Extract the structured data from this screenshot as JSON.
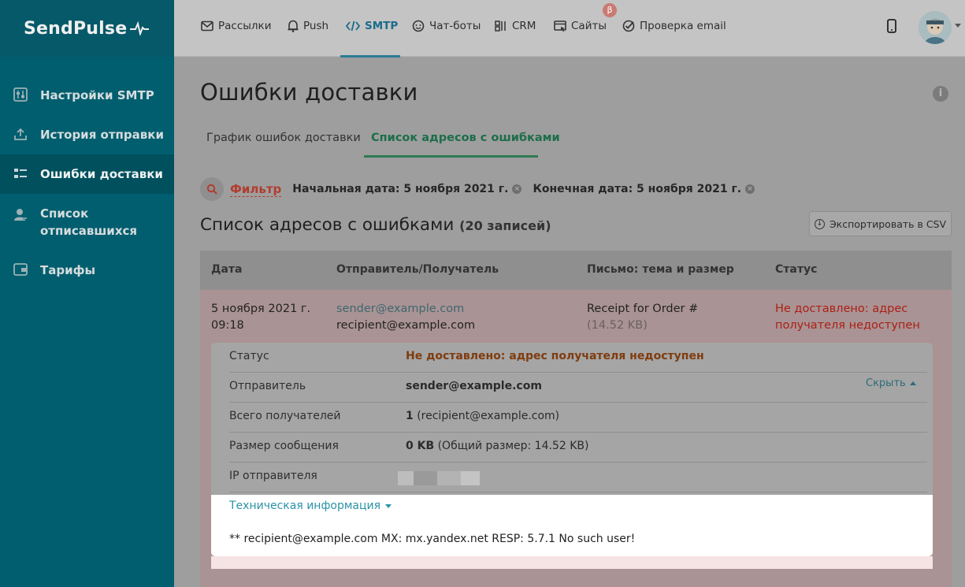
{
  "brand": {
    "name": "SendPulse"
  },
  "nav": {
    "items": [
      {
        "label": "Рассылки",
        "icon": "mail-icon"
      },
      {
        "label": "Push",
        "icon": "bell-icon"
      },
      {
        "label": "SMTP",
        "icon": "code-icon",
        "active": true
      },
      {
        "label": "Чат-боты",
        "icon": "chatbot-icon"
      },
      {
        "label": "CRM",
        "icon": "crm-icon"
      },
      {
        "label": "Сайты",
        "icon": "site-icon"
      },
      {
        "label": "Проверка email",
        "icon": "check-icon"
      }
    ],
    "beta_badge": "β"
  },
  "sidebar": {
    "items": [
      {
        "label": "Настройки SMTP",
        "icon": "settings-sliders-icon"
      },
      {
        "label": "История отправки",
        "icon": "upload-icon"
      },
      {
        "label": "Ошибки доставки",
        "icon": "error-list-icon",
        "active": true
      },
      {
        "label": "Список отписавшихся",
        "icon": "unsubscribed-icon"
      },
      {
        "label": "Тарифы",
        "icon": "wallet-icon"
      }
    ]
  },
  "page": {
    "title": "Ошибки доставки",
    "info_icon": "i",
    "tabs": [
      {
        "label": "График ошибок доставки"
      },
      {
        "label": "Список адресов с ошибками",
        "active": true
      }
    ],
    "filter": {
      "label": "Фильтр",
      "start": "Начальная дата: 5 ноября 2021 г.",
      "end": "Конечная дата: 5 ноября 2021 г.",
      "clear": "×"
    },
    "list_title": "Список адресов с ошибками",
    "list_count": "(20 записей)",
    "export_label": "Экспортировать в CSV"
  },
  "table": {
    "headers": [
      "Дата",
      "Отправитель/Получатель",
      "Письмо: тема и размер",
      "Статус"
    ],
    "rows": [
      {
        "date": "5 ноября 2021 г.",
        "time": "09:18",
        "sender": "sender@example.com",
        "recipient": "recipient@example.com",
        "subject": "Receipt for Order #",
        "size": "(14.52 KB)",
        "status_line1": "Не доставлено: адрес",
        "status_line2": "получателя недоступен"
      }
    ]
  },
  "details": {
    "status_label": "Статус",
    "status_value": "Не доставлено: адрес получателя недоступен",
    "sender_label": "Отправитель",
    "sender_value": "sender@example.com",
    "recipients_label": "Всего получателей",
    "recipients_count": "1",
    "recipients_detail": "(recipient@example.com)",
    "size_label": "Размер сообщения",
    "size_value": "0 KB",
    "size_detail": "(Общий размер: 14.52 KB)",
    "ip_label": "IP отправителя",
    "tech_link": "Техническая информация",
    "tech_text": "** recipient@example.com MX: mx.yandex.net RESP: 5.7.1 No such user!",
    "hide_link": "Скрыть"
  }
}
